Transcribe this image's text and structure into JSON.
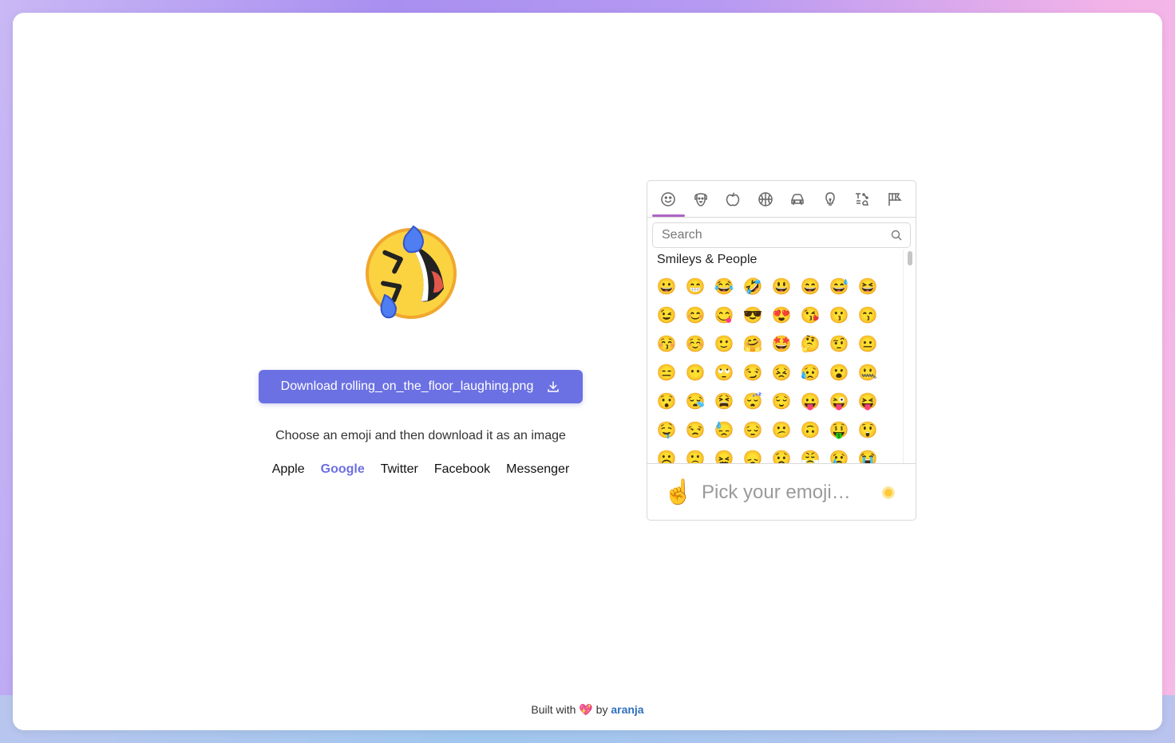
{
  "main": {
    "preview_emoji": "rolling_on_the_floor_laughing",
    "download_label": "Download rolling_on_the_floor_laughing.png",
    "subtitle": "Choose an emoji and then download it as an image",
    "vendors": [
      "Apple",
      "Google",
      "Twitter",
      "Facebook",
      "Messenger"
    ],
    "active_vendor": "Google",
    "accent_color": "#6b70e3"
  },
  "picker": {
    "categories": [
      "smileys-icon",
      "animals-icon",
      "food-icon",
      "activity-icon",
      "travel-icon",
      "objects-icon",
      "symbols-icon",
      "flags-icon"
    ],
    "active_category": "smileys-icon",
    "search_placeholder": "Search",
    "section_label": "Smileys & People",
    "emojis": [
      "😀",
      "😁",
      "😂",
      "🤣",
      "😃",
      "😄",
      "😅",
      "😆",
      "😉",
      "😊",
      "😋",
      "😎",
      "😍",
      "😘",
      "😗",
      "😙",
      "😚",
      "☺️",
      "🙂",
      "🤗",
      "🤩",
      "🤔",
      "🤨",
      "😐",
      "😑",
      "😶",
      "🙄",
      "😏",
      "😣",
      "😥",
      "😮",
      "🤐",
      "😯",
      "😪",
      "😫",
      "😴",
      "😌",
      "😛",
      "😜",
      "😝",
      "🤤",
      "😒",
      "😓",
      "😔",
      "😕",
      "🙃",
      "🤑",
      "😲",
      "☹️",
      "🙁",
      "😖",
      "😞",
      "😟",
      "😤",
      "😢",
      "😭"
    ],
    "preview_emoji": "☝️",
    "preview_text": "Pick your emoji…",
    "highlight_color": "#ae65c5"
  },
  "footer": {
    "prefix": "Built with",
    "heart": "💖",
    "by": "by",
    "author": "aranja"
  }
}
